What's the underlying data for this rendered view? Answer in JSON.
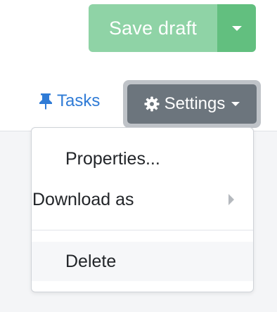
{
  "toolbar": {
    "save_label": "Save draft",
    "tasks_label": "Tasks",
    "settings_label": "Settings"
  },
  "menu": {
    "items": [
      {
        "label": "Properties..."
      },
      {
        "label": "Download as"
      },
      {
        "label": "Delete"
      }
    ]
  },
  "colors": {
    "save_main": "#8fd3a6",
    "save_caret": "#62bf7f",
    "settings_bg": "#6c757d",
    "link": "#2f7bd6"
  },
  "icons": {
    "tasks": "pushpin-icon",
    "settings": "gear-icon",
    "save_dropdown": "caret-down-icon",
    "submenu": "chevron-right-icon"
  }
}
